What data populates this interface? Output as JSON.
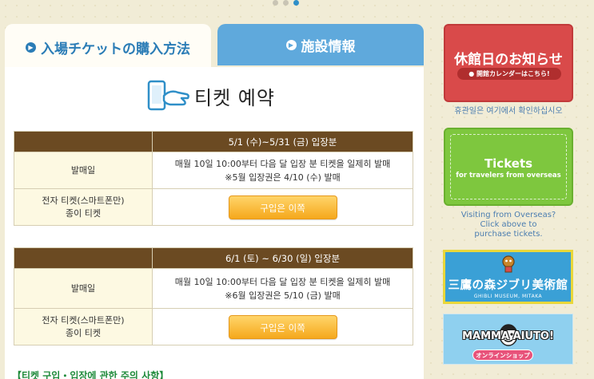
{
  "tabs": {
    "tickets_label": "入場チケットの購入方法",
    "facility_label": "施設情報"
  },
  "heading": {
    "title": "티켓 예약"
  },
  "periods": [
    {
      "header": "5/1 (수)~5/31 (금) 입장분",
      "release_label": "발매일",
      "release_line1": "매월 10일 10:00부터 다음 달 입장 분 티켓을 일제히 발매",
      "release_line2": "※5월 입장권은 4/10 (수) 발매",
      "ticket_type_line1": "전자 티켓(스마트폰만)",
      "ticket_type_line2": "종이 티켓",
      "buy_label": "구입은 이쪽"
    },
    {
      "header": "6/1 (토) ~ 6/30 (일) 입장분",
      "release_label": "발매일",
      "release_line1": "매월 10일 10:00부터 다음 달 입장 분 티켓을 일제히 발매",
      "release_line2": "※6월 입장권은 5/10 (금) 발매",
      "ticket_type_line1": "전자 티켓(스마트폰만)",
      "ticket_type_line2": "종이 티켓",
      "buy_label": "구입은 이쪽"
    }
  ],
  "notice_link": "【티켓 구입・입장에 관한 주의 사항】",
  "sidebar": {
    "closed_title": "休館日のお知らせ",
    "closed_calendar": "● 開館カレンダーはこちら!",
    "closed_caption": "휴관일은 여기에서 확인하십시오",
    "tickets_title": "Tickets",
    "tickets_subtitle": "for travelers from overseas",
    "overseas_line1": "Visiting from Overseas?",
    "overseas_line2": "Click above to",
    "overseas_line3": "purchase tickets.",
    "ghibli_title": "三鷹の森ジブリ美術館",
    "ghibli_subtitle": "GHIBLI MUSEUM, MITAKA",
    "mamma_title": "MAMMA AIUTO!",
    "mamma_shop": "オンラインショップ"
  },
  "colors": {
    "tab_active_text": "#2a7cb6",
    "tab_inactive_bg": "#5fa9dc",
    "table_header_bg": "#6b4a22",
    "buy_button": "#f5a81c",
    "closed_bg": "#d94a4a",
    "tickets_bg": "#7ec73e"
  },
  "icons": [
    "phone-hand-icon",
    "circle-arrow-icon"
  ]
}
